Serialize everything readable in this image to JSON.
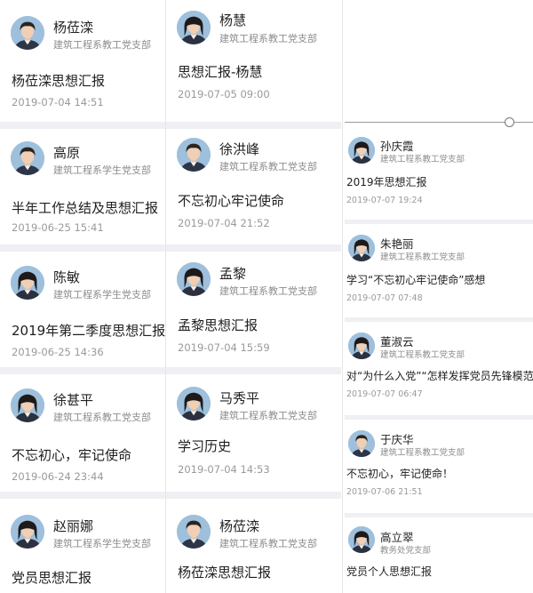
{
  "colors": {
    "separator": "#eff0f3",
    "name_text": "#222222",
    "dept_text": "#8d8d8d",
    "time_text": "#9a9a9a",
    "avatar_bg": "#9bb7cf"
  },
  "columns": [
    {
      "posts": [
        {
          "name": "杨莅滦",
          "dept": "建筑工程系教工党支部",
          "title": "杨莅滦思想汇报",
          "time": "2019-07-04 14:51",
          "avatar": "male"
        },
        {
          "name": "高原",
          "dept": "建筑工程系学生党支部",
          "title": "半年工作总结及思想汇报",
          "time": "2019-06-25 15:41",
          "avatar": "male"
        },
        {
          "name": "陈敏",
          "dept": "建筑工程系学生党支部",
          "title": "2019年第二季度思想汇报",
          "time": "2019-06-25 14:36",
          "avatar": "female"
        },
        {
          "name": "徐甚平",
          "dept": "建筑工程系教工党支部",
          "title": "不忘初心，牢记使命",
          "time": "2019-06-24 23:44",
          "avatar": "female"
        },
        {
          "name": "赵丽娜",
          "dept": "建筑工程系学生党支部",
          "title": "党员思想汇报",
          "time": "",
          "avatar": "female"
        }
      ]
    },
    {
      "posts": [
        {
          "name": "杨慧",
          "dept": "建筑工程系教工党支部",
          "title": "思想汇报-杨慧",
          "time": "2019-07-05 09:00",
          "avatar": "female"
        },
        {
          "name": "徐洪峰",
          "dept": "建筑工程系教工党支部",
          "title": "不忘初心牢记使命",
          "time": "2019-07-04 21:52",
          "avatar": "male"
        },
        {
          "name": "孟黎",
          "dept": "建筑工程系教工党支部",
          "title": "孟黎思想汇报",
          "time": "2019-07-04 15:59",
          "avatar": "female"
        },
        {
          "name": "马秀平",
          "dept": "建筑工程系教工党支部",
          "title": "学习历史",
          "time": "2019-07-04 14:53",
          "avatar": "female"
        },
        {
          "name": "杨莅滦",
          "dept": "建筑工程系教工党支部",
          "title": "杨莅滦思想汇报",
          "time": "",
          "avatar": "male"
        }
      ]
    },
    {
      "posts": [
        {
          "name": "孙庆霞",
          "dept": "建筑工程系教工党支部",
          "title": "2019年思想汇报",
          "time": "2019-07-07 19:24",
          "avatar": "female"
        },
        {
          "name": "朱艳丽",
          "dept": "建筑工程系教工党支部",
          "title": "学习“不忘初心牢记使命”感想",
          "time": "2019-07-07 07:48",
          "avatar": "female"
        },
        {
          "name": "董淑云",
          "dept": "建筑工程系教工党支部",
          "title": "对“为什么入党”“怎样发挥党员先锋模范",
          "time": "2019-07-07 06:47",
          "avatar": "female"
        },
        {
          "name": "于庆华",
          "dept": "建筑工程系教工党支部",
          "title": "不忘初心，牢记使命！",
          "time": "2019-07-06 21:51",
          "avatar": "male"
        },
        {
          "name": "高立翠",
          "dept": "教务处党支部",
          "title": "党员个人思想汇报",
          "time": "",
          "avatar": "female"
        }
      ]
    }
  ]
}
